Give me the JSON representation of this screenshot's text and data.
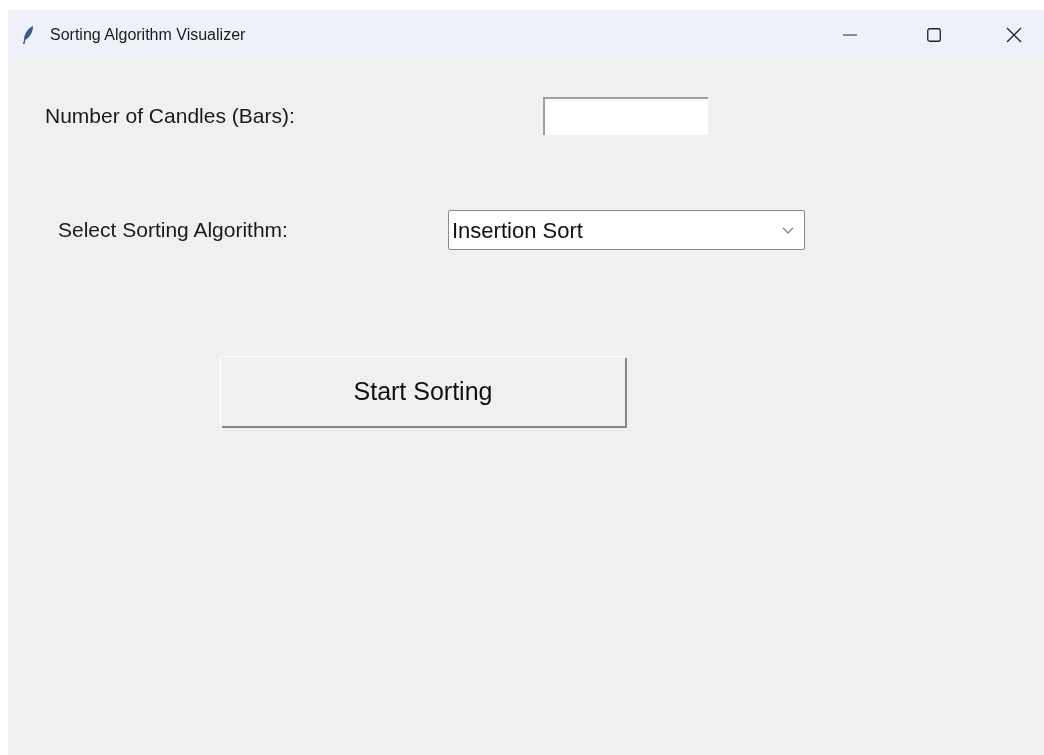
{
  "window": {
    "title": "Sorting Algorithm Visualizer"
  },
  "candles_field": {
    "label": "Number of Candles (Bars):"
  },
  "algorithm_select": {
    "label": "Select Sorting Algorithm:",
    "value": "Insertion Sort"
  },
  "start_button": {
    "label": "Start Sorting"
  }
}
